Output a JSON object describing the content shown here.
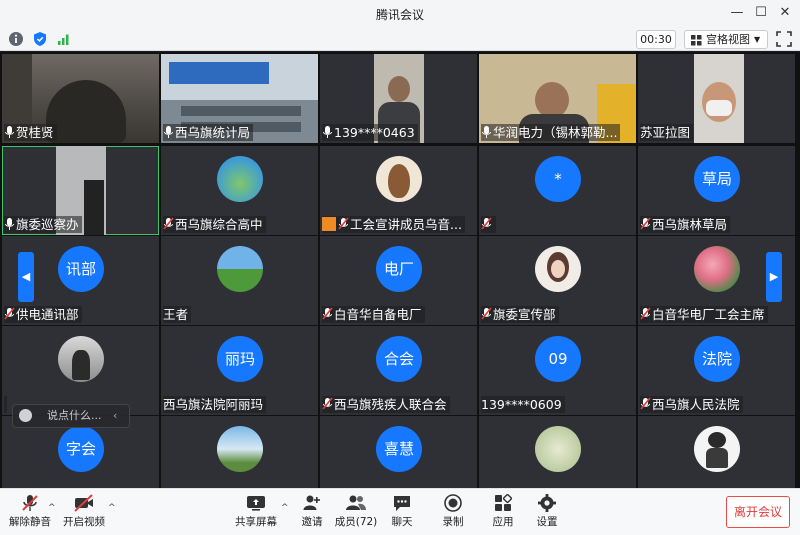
{
  "window": {
    "title": "腾讯会议"
  },
  "statusbar": {
    "timer": "00:30",
    "view_label": "宫格视图"
  },
  "colors": {
    "accent": "#1677ff",
    "muted_mic": "#e03c3c",
    "active_speaker": "#3ec26a",
    "leave": "#e03c3c"
  },
  "tiles": [
    {
      "name": "贺桂贤",
      "mic": "on"
    },
    {
      "name": "西乌旗统计局",
      "mic": "on"
    },
    {
      "name": "139****0463",
      "mic": "on"
    },
    {
      "name": "华润电力（锡林郭勒...",
      "mic": "on"
    },
    {
      "name": "苏亚拉图",
      "mic": "none"
    },
    {
      "name": "旗委巡察办",
      "mic": "on"
    },
    {
      "name": "西乌旗综合高中",
      "mic": "muted"
    },
    {
      "name": "工会宣讲成员乌音...",
      "mic": "muted"
    },
    {
      "name": "",
      "avatar_text": "*",
      "mic": "muted"
    },
    {
      "name": "西乌旗林草局",
      "avatar_text": "草局",
      "mic": "muted"
    },
    {
      "name": "供电通讯部",
      "avatar_text": "讯部",
      "mic": "muted"
    },
    {
      "name": "王者",
      "mic": "none"
    },
    {
      "name": "白音华自备电厂",
      "avatar_text": "电厂",
      "mic": "muted"
    },
    {
      "name": "旗委宣传部",
      "mic": "muted"
    },
    {
      "name": "白音华电厂工会主席",
      "mic": "muted"
    },
    {
      "name": "",
      "mic": "none"
    },
    {
      "name": "西乌旗法院阿丽玛",
      "avatar_text": "丽玛",
      "mic": "none"
    },
    {
      "name": "西乌旗残疾人联合会",
      "avatar_text": "合会",
      "mic": "muted"
    },
    {
      "name": "139****0609",
      "avatar_text": "09",
      "mic": "none"
    },
    {
      "name": "西乌旗人民法院",
      "avatar_text": "法院",
      "mic": "muted"
    },
    {
      "name": "",
      "avatar_text": "字会",
      "mic": "none"
    },
    {
      "name": "",
      "mic": "none"
    },
    {
      "name": "",
      "avatar_text": "喜慧",
      "mic": "none"
    },
    {
      "name": "",
      "mic": "none"
    },
    {
      "name": "",
      "mic": "none"
    }
  ],
  "chat": {
    "placeholder": "说点什么..."
  },
  "toolbar": {
    "unmute": "解除静音",
    "start_video": "开启视频",
    "share_screen": "共享屏幕",
    "invite": "邀请",
    "members": "成员(72)",
    "chat": "聊天",
    "record": "录制",
    "apps": "应用",
    "settings": "设置",
    "leave": "离开会议"
  }
}
